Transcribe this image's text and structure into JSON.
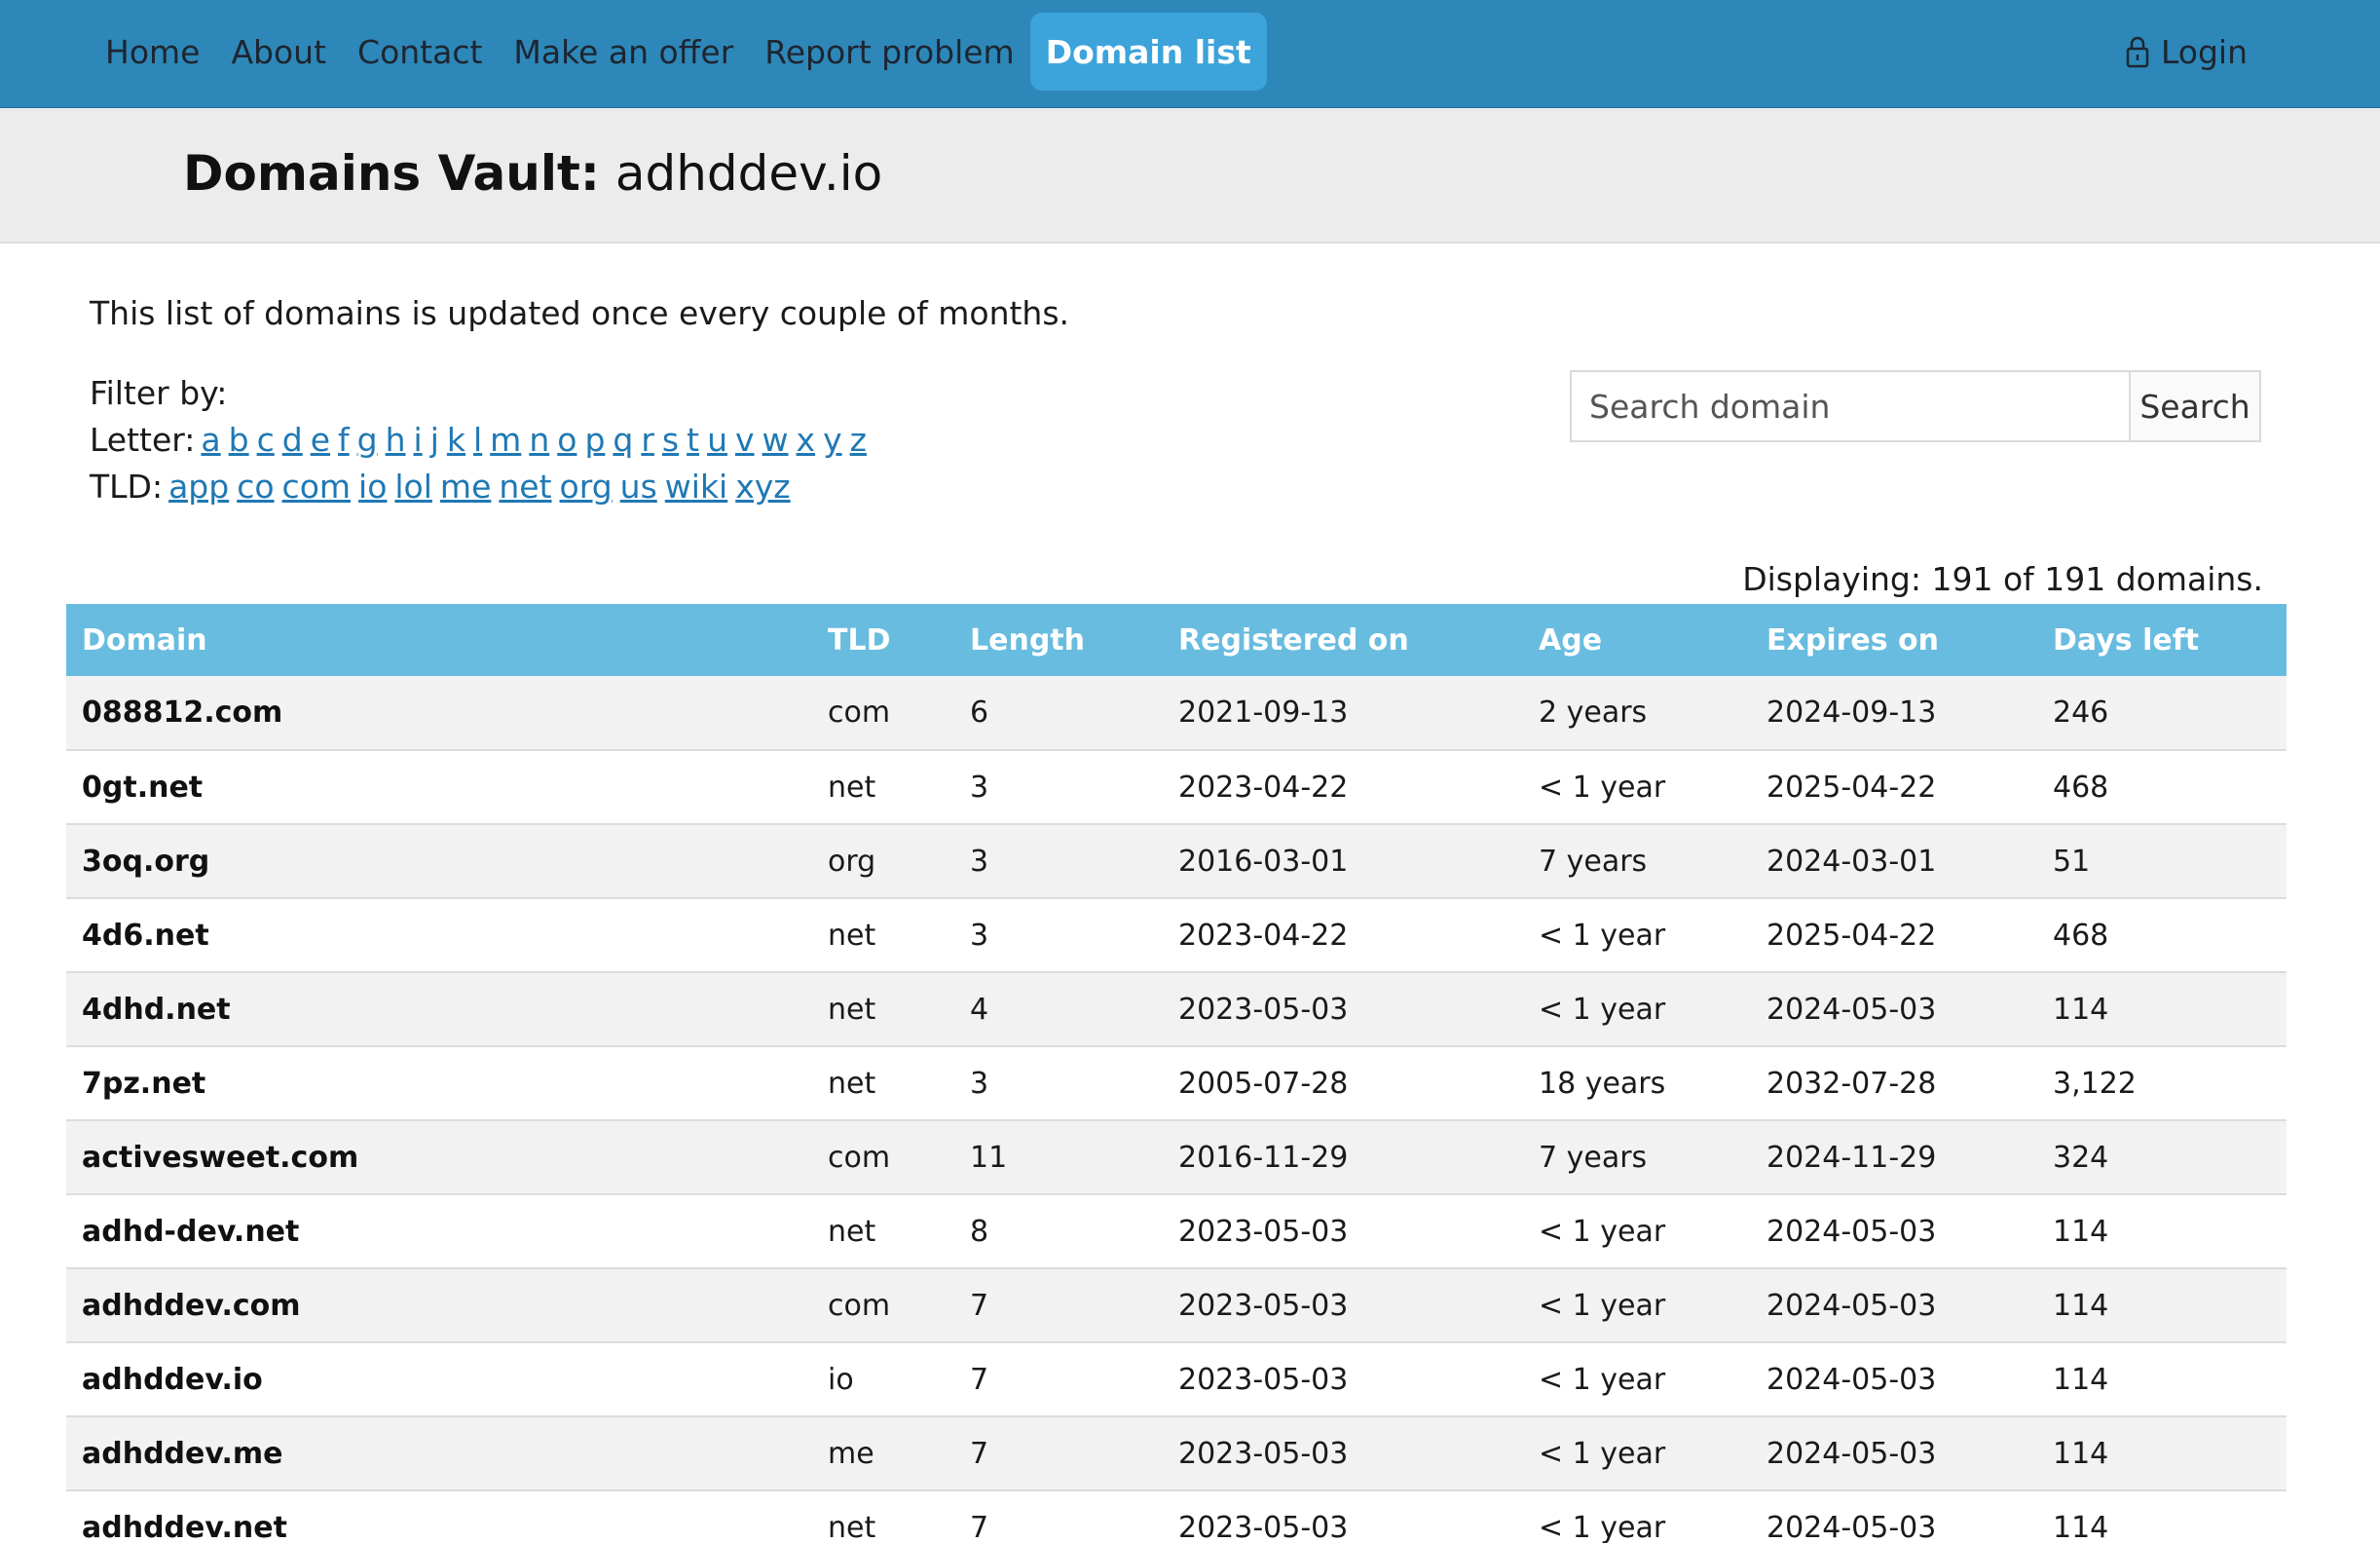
{
  "nav": {
    "items": [
      {
        "label": "Home"
      },
      {
        "label": "About"
      },
      {
        "label": "Contact"
      },
      {
        "label": "Make an offer"
      },
      {
        "label": "Report problem"
      },
      {
        "label": "Domain list"
      }
    ],
    "active": "Domain list",
    "login_label": "Login",
    "login_icon": "lock-icon"
  },
  "header": {
    "title_strong": "Domains Vault:",
    "title_name": "adhddev.io"
  },
  "intro_text": "This list of domains is updated once every couple of months.",
  "filter": {
    "heading": "Filter by:",
    "letter_label": "Letter:",
    "letters": [
      "a",
      "b",
      "c",
      "d",
      "e",
      "f",
      "g",
      "h",
      "i",
      "j",
      "k",
      "l",
      "m",
      "n",
      "o",
      "p",
      "q",
      "r",
      "s",
      "t",
      "u",
      "v",
      "w",
      "x",
      "y",
      "z"
    ],
    "tld_label": "TLD:",
    "tlds": [
      "app",
      "co",
      "com",
      "io",
      "lol",
      "me",
      "net",
      "org",
      "us",
      "wiki",
      "xyz"
    ]
  },
  "search": {
    "placeholder": "Search domain",
    "button_label": "Search"
  },
  "displaying_text": "Displaying: 191 of 191 domains.",
  "table": {
    "headers": [
      "Domain",
      "TLD",
      "Length",
      "Registered on",
      "Age",
      "Expires on",
      "Days left"
    ],
    "rows": [
      [
        "088812.com",
        "com",
        "6",
        "2021-09-13",
        "2 years",
        "2024-09-13",
        "246"
      ],
      [
        "0gt.net",
        "net",
        "3",
        "2023-04-22",
        "< 1 year",
        "2025-04-22",
        "468"
      ],
      [
        "3oq.org",
        "org",
        "3",
        "2016-03-01",
        "7 years",
        "2024-03-01",
        "51"
      ],
      [
        "4d6.net",
        "net",
        "3",
        "2023-04-22",
        "< 1 year",
        "2025-04-22",
        "468"
      ],
      [
        "4dhd.net",
        "net",
        "4",
        "2023-05-03",
        "< 1 year",
        "2024-05-03",
        "114"
      ],
      [
        "7pz.net",
        "net",
        "3",
        "2005-07-28",
        "18 years",
        "2032-07-28",
        "3,122"
      ],
      [
        "activesweet.com",
        "com",
        "11",
        "2016-11-29",
        "7 years",
        "2024-11-29",
        "324"
      ],
      [
        "adhd-dev.net",
        "net",
        "8",
        "2023-05-03",
        "< 1 year",
        "2024-05-03",
        "114"
      ],
      [
        "adhddev.com",
        "com",
        "7",
        "2023-05-03",
        "< 1 year",
        "2024-05-03",
        "114"
      ],
      [
        "adhddev.io",
        "io",
        "7",
        "2023-05-03",
        "< 1 year",
        "2024-05-03",
        "114"
      ],
      [
        "adhddev.me",
        "me",
        "7",
        "2023-05-03",
        "< 1 year",
        "2024-05-03",
        "114"
      ],
      [
        "adhddev.net",
        "net",
        "7",
        "2023-05-03",
        "< 1 year",
        "2024-05-03",
        "114"
      ]
    ]
  }
}
